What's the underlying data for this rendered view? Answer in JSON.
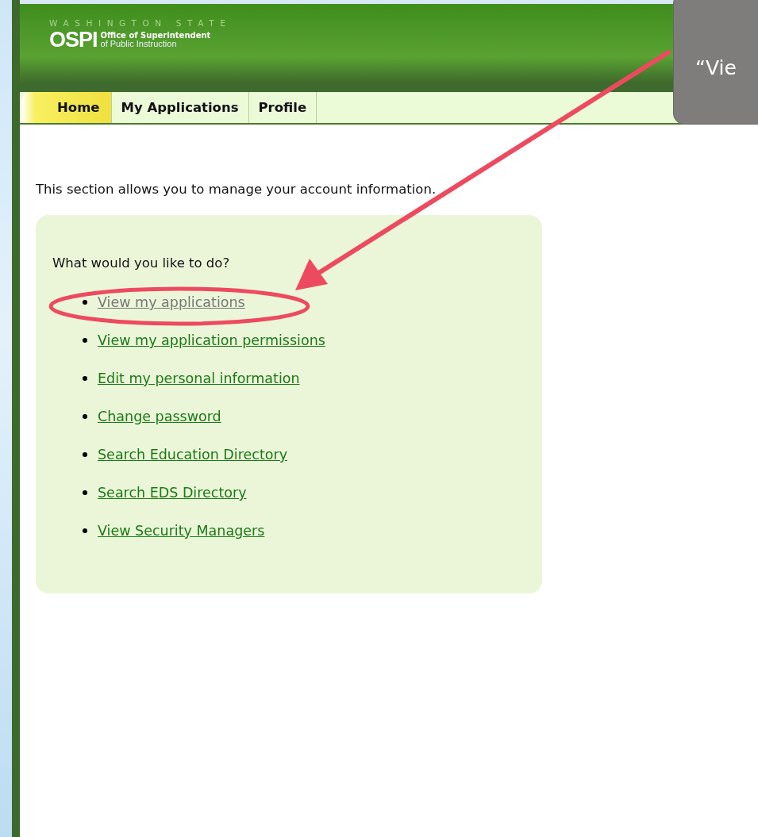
{
  "header": {
    "state_line": "WASHINGTON STATE",
    "logo": "OSPI",
    "org_line_1": "Office of Superintendent",
    "org_line_2": "of Public Instruction"
  },
  "tabs": [
    {
      "label": "Home",
      "selected": true
    },
    {
      "label": "My Applications",
      "selected": false
    },
    {
      "label": "Profile",
      "selected": false
    }
  ],
  "intro": "This section allows you to manage your account information.",
  "panel": {
    "question": "What would you like to do?",
    "links": [
      {
        "label": "View my applications",
        "visited": true
      },
      {
        "label": "View my application permissions",
        "visited": false
      },
      {
        "label": "Edit my personal information",
        "visited": false
      },
      {
        "label": "Change password",
        "visited": false
      },
      {
        "label": "Search Education Directory",
        "visited": false
      },
      {
        "label": "Search EDS Directory",
        "visited": false
      },
      {
        "label": "View Security Managers",
        "visited": false
      }
    ]
  },
  "callout": {
    "text": "“Vie"
  }
}
